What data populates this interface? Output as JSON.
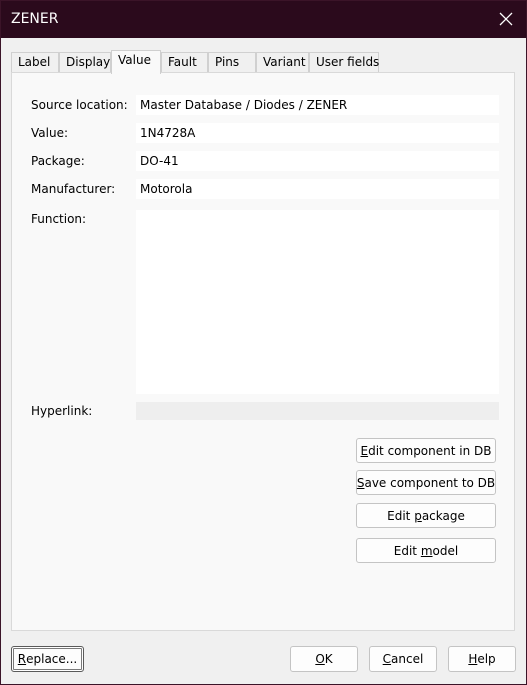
{
  "window": {
    "title": "ZENER"
  },
  "tabs": [
    {
      "label": "Label"
    },
    {
      "label": "Display"
    },
    {
      "label": "Value"
    },
    {
      "label": "Fault"
    },
    {
      "label": "Pins"
    },
    {
      "label": "Variant"
    },
    {
      "label": "User fields"
    }
  ],
  "active_tab": "Value",
  "form": {
    "source_location": {
      "label": "Source location:",
      "value": "Master Database / Diodes / ZENER"
    },
    "value": {
      "label": "Value:",
      "value": "1N4728A"
    },
    "package": {
      "label": "Package:",
      "value": "DO-41"
    },
    "manufacturer": {
      "label": "Manufacturer:",
      "value": "Motorola"
    },
    "function": {
      "label": "Function:",
      "value": ""
    },
    "hyperlink": {
      "label": "Hyperlink:",
      "value": ""
    }
  },
  "actions": {
    "edit_component": {
      "pre": "",
      "mnemonic": "E",
      "post": "dit component in DB"
    },
    "save_component": {
      "pre": "",
      "mnemonic": "S",
      "post": "ave component to DB"
    },
    "edit_package": {
      "pre": "Edit ",
      "mnemonic": "p",
      "post": "ackage"
    },
    "edit_model": {
      "pre": "Edit ",
      "mnemonic": "m",
      "post": "odel"
    }
  },
  "footer": {
    "replace": {
      "pre": "",
      "mnemonic": "R",
      "post": "eplace..."
    },
    "ok": {
      "pre": "",
      "mnemonic": "O",
      "post": "K"
    },
    "cancel": {
      "pre": "",
      "mnemonic": "C",
      "post": "ancel"
    },
    "help": {
      "pre": "",
      "mnemonic": "H",
      "post": "elp"
    }
  },
  "icons": {
    "close": "close-icon"
  }
}
